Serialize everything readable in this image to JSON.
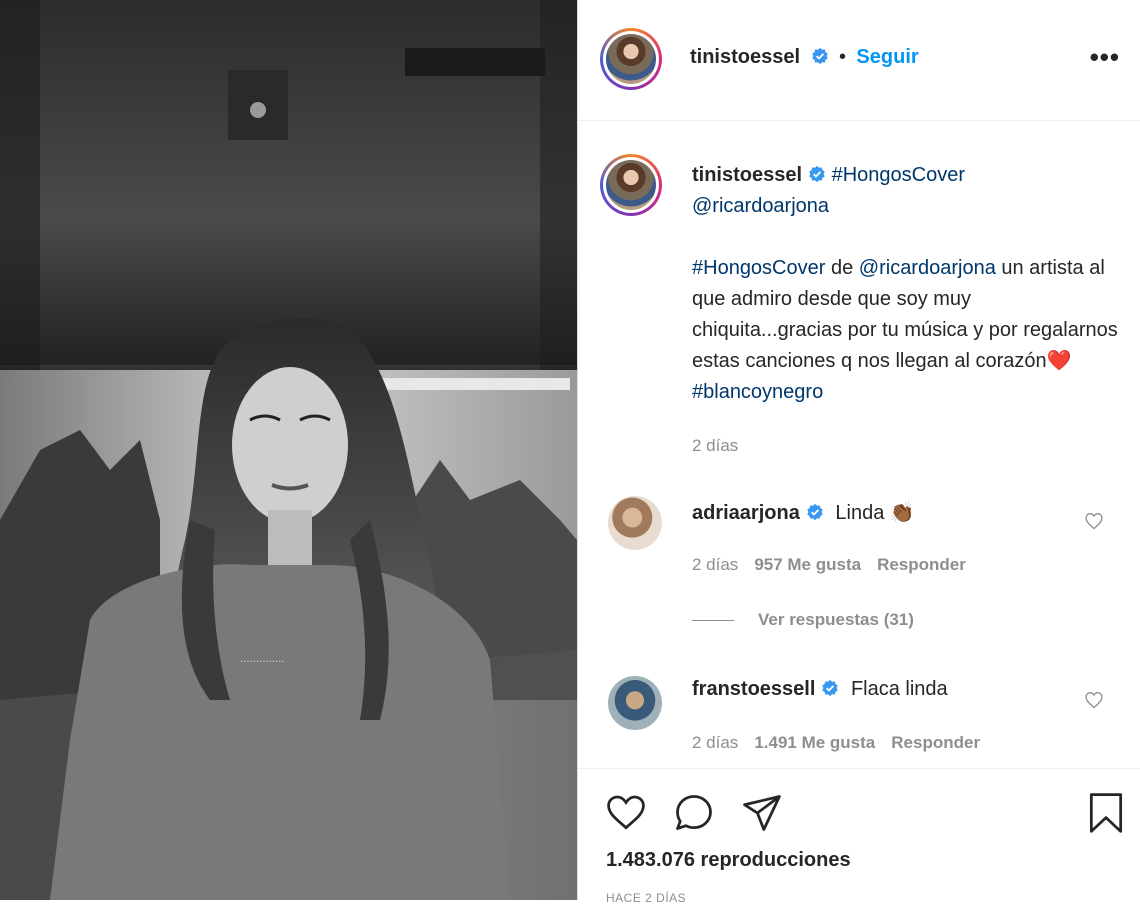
{
  "post": {
    "username": "tinistoessel",
    "follow_label": "Seguir",
    "separator": "•",
    "more_label": "•••",
    "caption_title_tag": "#HongosCover",
    "caption_title_mention": "@ricardoarjona",
    "caption_tag1": "#HongosCover",
    "caption_de": " de ",
    "caption_mention": "@ricardoarjona",
    "caption_text": " un artista al que admiro desde que soy muy chiquita...gracias por tu música y por regalarnos estas canciones q nos llegan al corazón",
    "caption_heart": "❤️",
    "caption_tag2": "#blancoynegro",
    "caption_time": "2 días"
  },
  "comments": [
    {
      "username": "adriaarjona",
      "text": "Linda",
      "emoji": "👏🏾",
      "time": "2 días",
      "likes": "957 Me gusta",
      "reply_label": "Responder"
    },
    {
      "username": "franstoessell",
      "text": "Flaca linda",
      "time": "2 días",
      "likes": "1.491 Me gusta",
      "reply_label": "Responder"
    }
  ],
  "view_replies": "Ver respuestas (31)",
  "stats": {
    "views": "1.483.076 reproducciones",
    "posted": "HACE 2 DÍAS"
  },
  "colors": {
    "accent": "#0095f6",
    "link": "#00376b",
    "muted": "#8e8e8e",
    "verified": "#3897f0"
  }
}
